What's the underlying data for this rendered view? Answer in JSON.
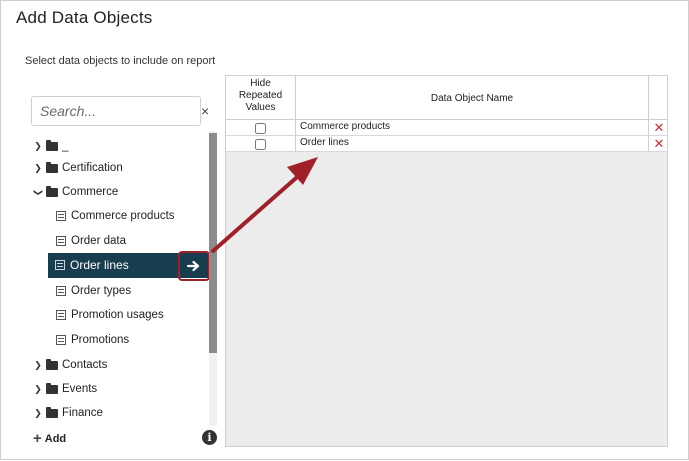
{
  "dialog": {
    "title": "Add Data Objects",
    "instructions": "Select data objects to include on report"
  },
  "search": {
    "placeholder": "Search...",
    "clear_label": "×"
  },
  "tree": {
    "items": [
      {
        "label": "_",
        "type": "folder",
        "expanded": false
      },
      {
        "label": "Certification",
        "type": "folder",
        "expanded": false
      },
      {
        "label": "Commerce",
        "type": "folder",
        "expanded": true
      },
      {
        "label": "Commerce products",
        "type": "object"
      },
      {
        "label": "Order data",
        "type": "object"
      },
      {
        "label": "Order lines",
        "type": "object",
        "selected": true
      },
      {
        "label": "Order types",
        "type": "object"
      },
      {
        "label": "Promotion usages",
        "type": "object"
      },
      {
        "label": "Promotions",
        "type": "object"
      },
      {
        "label": "Contacts",
        "type": "folder",
        "expanded": false
      },
      {
        "label": "Events",
        "type": "folder",
        "expanded": false
      },
      {
        "label": "Finance",
        "type": "folder",
        "expanded": false
      }
    ],
    "add_label": "Add"
  },
  "grid": {
    "col_hide_line1": "Hide",
    "col_hide_line2": "Repeated",
    "col_hide_line3": "Values",
    "col_name": "Data Object Name",
    "rows": [
      {
        "name": "Commerce products",
        "hide_repeated": false
      },
      {
        "name": "Order lines",
        "hide_repeated": false
      }
    ]
  },
  "colors": {
    "selected_bg": "#173d4f",
    "callout": "#a0202a",
    "delete": "#d9293a"
  },
  "icons": {
    "add_to_report": "arrow-right-icon",
    "delete": "x-icon",
    "info": "info-icon",
    "plus": "plus-icon"
  }
}
